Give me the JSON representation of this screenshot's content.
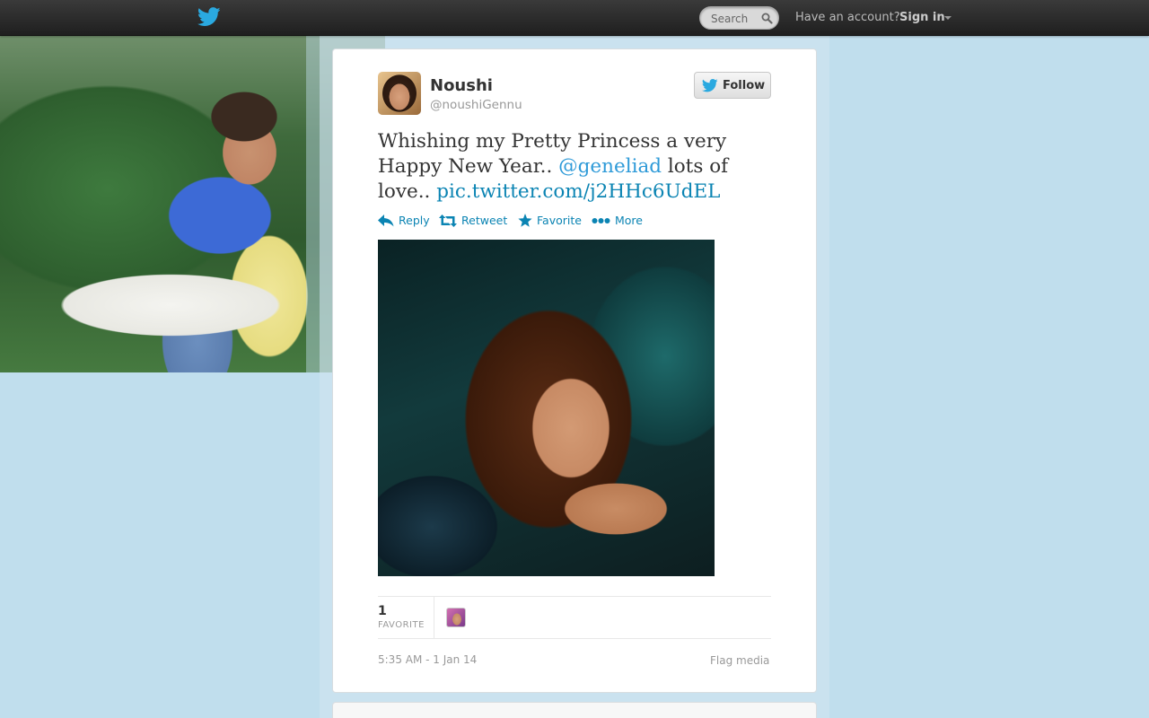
{
  "topbar": {
    "search": {
      "placeholder": "Search"
    },
    "account_prompt": "Have an account?",
    "signin_label": "Sign in"
  },
  "tweet": {
    "author": {
      "name": "Noushi",
      "handle": "@noushiGennu"
    },
    "follow_label": "Follow",
    "text": {
      "part1": "Whishing my Pretty Princess a very Happy New Year.. ",
      "mention": "@geneliad",
      "part2": " lots of love.. ",
      "link": "pic.twitter.com/j2HHc6UdEL"
    },
    "actions": {
      "reply": "Reply",
      "retweet": "Retweet",
      "favorite": "Favorite",
      "more": "More"
    },
    "stats": {
      "favorite_count": "1",
      "favorite_label": "FAVORITE"
    },
    "timestamp": "5:35 AM - 1 Jan 14",
    "flag_label": "Flag media"
  },
  "colors": {
    "link": "#0b84b3",
    "mention": "#2e9ad8",
    "background": "#c0deed",
    "topbar": "#2a2a2a"
  },
  "icons": [
    "twitter-bird-icon",
    "search-icon",
    "reply-icon",
    "retweet-icon",
    "star-icon",
    "more-icon"
  ]
}
